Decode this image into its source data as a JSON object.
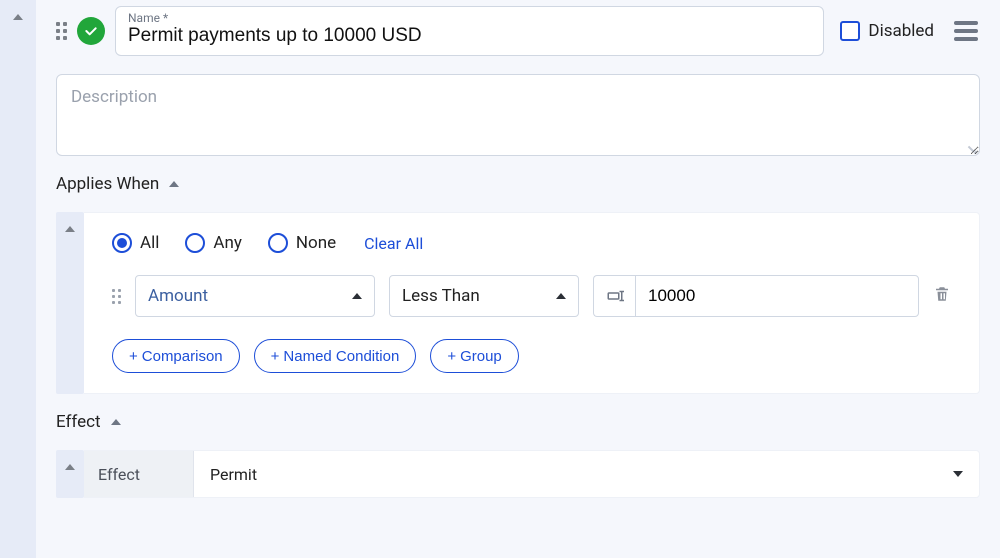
{
  "header": {
    "name_label": "Name *",
    "name_value": "Permit payments up to 10000 USD",
    "disabled_label": "Disabled",
    "disabled_checked": false
  },
  "description": {
    "placeholder": "Description",
    "value": ""
  },
  "sections": {
    "applies_when_title": "Applies When",
    "effect_title": "Effect"
  },
  "match": {
    "options": [
      {
        "label": "All",
        "value": "all",
        "selected": true
      },
      {
        "label": "Any",
        "value": "any",
        "selected": false
      },
      {
        "label": "None",
        "value": "none",
        "selected": false
      }
    ],
    "clear_all_label": "Clear All"
  },
  "condition": {
    "field": "Amount",
    "operator": "Less Than",
    "value": "10000"
  },
  "add_buttons": {
    "comparison": "Comparison",
    "named_condition": "Named Condition",
    "group": "Group"
  },
  "effect": {
    "label": "Effect",
    "value": "Permit"
  }
}
